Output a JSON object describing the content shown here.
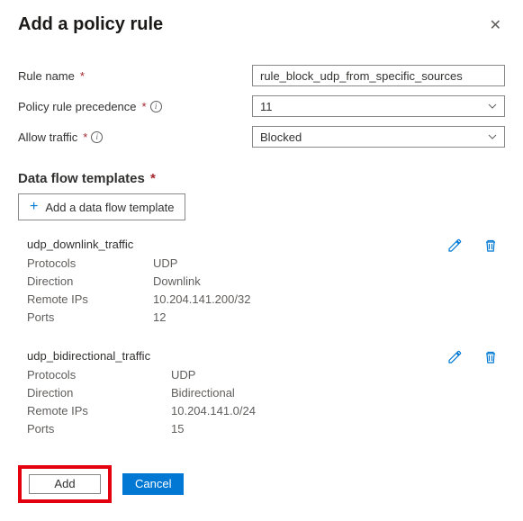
{
  "title": "Add a policy rule",
  "form": {
    "ruleName": {
      "label": "Rule name",
      "value": "rule_block_udp_from_specific_sources"
    },
    "precedence": {
      "label": "Policy rule precedence",
      "value": "11"
    },
    "allowTraffic": {
      "label": "Allow traffic",
      "value": "Blocked"
    }
  },
  "dataFlow": {
    "sectionTitle": "Data flow templates",
    "addLabel": "Add a data flow template",
    "keys": {
      "protocols": "Protocols",
      "direction": "Direction",
      "remoteIps": "Remote IPs",
      "ports": "Ports"
    },
    "templates": [
      {
        "name": "udp_downlink_traffic",
        "protocols": "UDP",
        "direction": "Downlink",
        "remoteIps": "10.204.141.200/32",
        "ports": "12"
      },
      {
        "name": "udp_bidirectional_traffic",
        "protocols": "UDP",
        "direction": "Bidirectional",
        "remoteIps": "10.204.141.0/24",
        "ports": "15"
      }
    ]
  },
  "footer": {
    "add": "Add",
    "cancel": "Cancel"
  }
}
